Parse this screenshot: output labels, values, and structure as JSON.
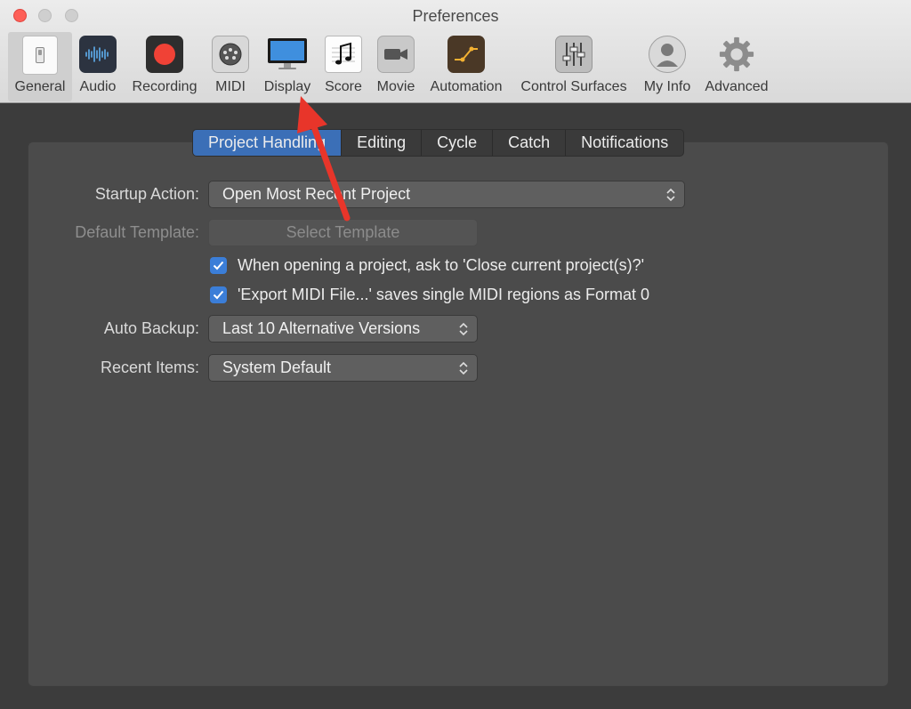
{
  "window": {
    "title": "Preferences"
  },
  "toolbar": {
    "items": [
      {
        "label": "General",
        "icon": "general-switch-icon"
      },
      {
        "label": "Audio",
        "icon": "audio-waveform-icon"
      },
      {
        "label": "Recording",
        "icon": "record-icon"
      },
      {
        "label": "MIDI",
        "icon": "midi-plug-icon"
      },
      {
        "label": "Display",
        "icon": "monitor-icon"
      },
      {
        "label": "Score",
        "icon": "music-note-icon"
      },
      {
        "label": "Movie",
        "icon": "video-camera-icon"
      },
      {
        "label": "Automation",
        "icon": "automation-icon"
      },
      {
        "label": "Control Surfaces",
        "icon": "faders-icon"
      },
      {
        "label": "My Info",
        "icon": "user-icon"
      },
      {
        "label": "Advanced",
        "icon": "gear-icon"
      }
    ],
    "selected": "General"
  },
  "tabs": {
    "items": [
      "Project Handling",
      "Editing",
      "Cycle",
      "Catch",
      "Notifications"
    ],
    "active": "Project Handling"
  },
  "settings": {
    "startup_action": {
      "label": "Startup Action:",
      "value": "Open Most Recent Project"
    },
    "default_template": {
      "label": "Default Template:",
      "button": "Select Template"
    },
    "checkboxes": [
      {
        "label": "When opening a project, ask to 'Close current project(s)?'",
        "checked": true
      },
      {
        "label": "'Export MIDI File...' saves single MIDI regions as Format 0",
        "checked": true
      }
    ],
    "auto_backup": {
      "label": "Auto Backup:",
      "value": "Last 10 Alternative Versions"
    },
    "recent_items": {
      "label": "Recent Items:",
      "value": "System Default"
    }
  },
  "colors": {
    "accent": "#3b6fb7",
    "checkbox": "#3b7ed8",
    "annotation_arrow": "#e8352a",
    "close_button": "#fe5f57"
  }
}
